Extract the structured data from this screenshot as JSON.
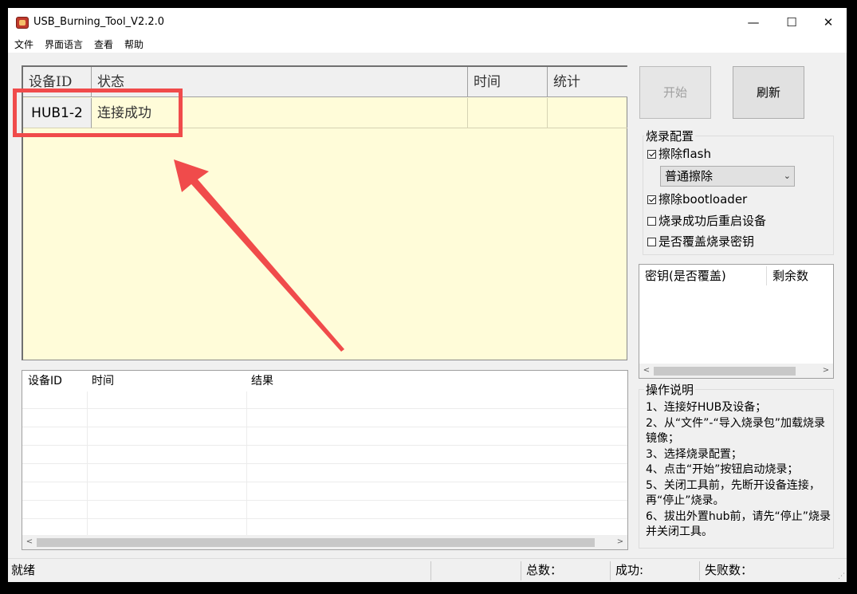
{
  "window": {
    "title": "USB_Burning_Tool_V2.2.0",
    "controls": {
      "minimize": "—",
      "maximize": "☐",
      "close": "✕"
    }
  },
  "menu": [
    "文件",
    "界面语言",
    "查看",
    "帮助"
  ],
  "device_grid": {
    "headers": [
      "设备ID",
      "状态",
      "时间",
      "统计"
    ],
    "rows": [
      {
        "id": "HUB1-2",
        "status": "连接成功",
        "time": "",
        "stats": ""
      }
    ]
  },
  "log_grid": {
    "headers": [
      "设备ID",
      "时间",
      "结果"
    ]
  },
  "buttons": {
    "start": "开始",
    "refresh": "刷新"
  },
  "burn_config": {
    "title": "烧录配置",
    "erase_flash": {
      "label": "擦除flash",
      "checked": true
    },
    "erase_mode": {
      "selected": "普通擦除"
    },
    "erase_bootloader": {
      "label": "擦除bootloader",
      "checked": true
    },
    "reboot_after": {
      "label": "烧录成功后重启设备",
      "checked": false
    },
    "overwrite_key": {
      "label": "是否覆盖烧录密钥",
      "checked": false
    }
  },
  "key_list": {
    "headers": [
      "密钥(是否覆盖)",
      "剩余数"
    ]
  },
  "instructions": {
    "title": "操作说明",
    "lines": [
      "1、连接好HUB及设备；",
      "2、从“文件”-“导入烧录包”加载烧录镜像；",
      "3、选择烧录配置；",
      "4、点击“开始”按钮启动烧录；",
      "5、关闭工具前，先断开设备连接，再“停止”烧录。",
      "6、拔出外置hub前，请先“停止”烧录并关闭工具。"
    ]
  },
  "status_bar": {
    "state": "就绪",
    "total": "总数：",
    "success": "成功:",
    "failed": "失败数："
  },
  "colors": {
    "grid_bg": "#fffcd9",
    "highlight": "#f04b4b"
  }
}
